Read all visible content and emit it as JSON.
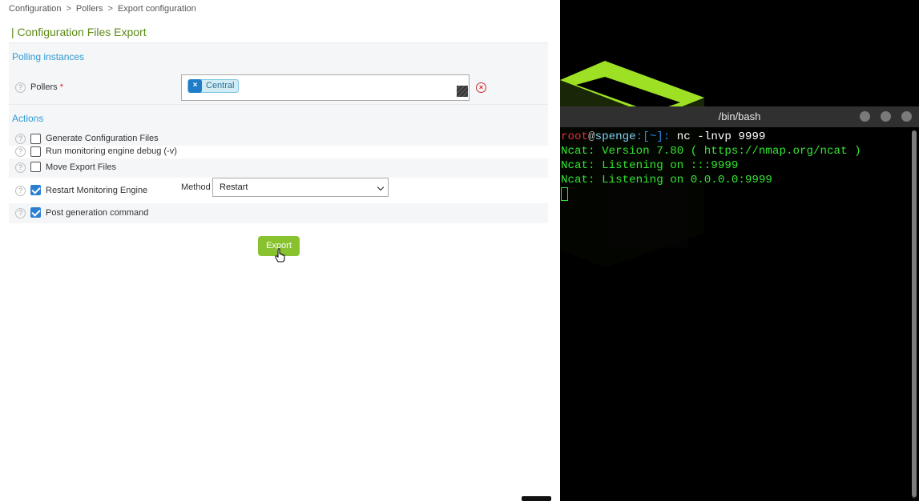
{
  "breadcrumb": [
    "Configuration",
    "Pollers",
    "Export configuration"
  ],
  "breadcrumb_separator": ">",
  "page_title": "| Configuration Files Export",
  "polling_section": {
    "title": "Polling instances",
    "pollers_label": "Pollers",
    "required_mark": "*",
    "selected_pollers": [
      "Central"
    ],
    "tag_remove_glyph": "×"
  },
  "actions_section": {
    "title": "Actions",
    "options": [
      {
        "label": "Generate Configuration Files",
        "checked": false
      },
      {
        "label": "Run monitoring engine debug (-v)",
        "checked": false
      },
      {
        "label": "Move Export Files",
        "checked": false
      },
      {
        "label": "Restart Monitoring Engine",
        "checked": true
      },
      {
        "label": "Post generation command",
        "checked": true
      }
    ],
    "method_label": "Method",
    "method_value": "Restart"
  },
  "export_label": "Export",
  "help_glyph": "?",
  "terminal": {
    "title": "/bin/bash",
    "prompt_user": "root",
    "prompt_at": "@",
    "prompt_host": "spenge",
    "prompt_path": ":[~]:",
    "command": " nc -lnvp 9999",
    "output": [
      "Ncat: Version 7.80 ( https://nmap.org/ncat )",
      "Ncat: Listening on :::9999",
      "Ncat: Listening on 0.0.0.0:9999"
    ]
  },
  "colors": {
    "accent_green": "#88c22e",
    "title_green": "#5b8a16",
    "link_blue": "#2e9bd2",
    "checkbox_blue": "#2a7fd1",
    "terminal_green": "#31e631",
    "error_red": "#d2282b"
  },
  "icons": {
    "help": "question-circle-icon",
    "clear": "clear-circle-icon",
    "tag_remove": "close-icon",
    "wallpaper": "cube-logo-icon",
    "cursor": "hand-pointer-icon"
  }
}
